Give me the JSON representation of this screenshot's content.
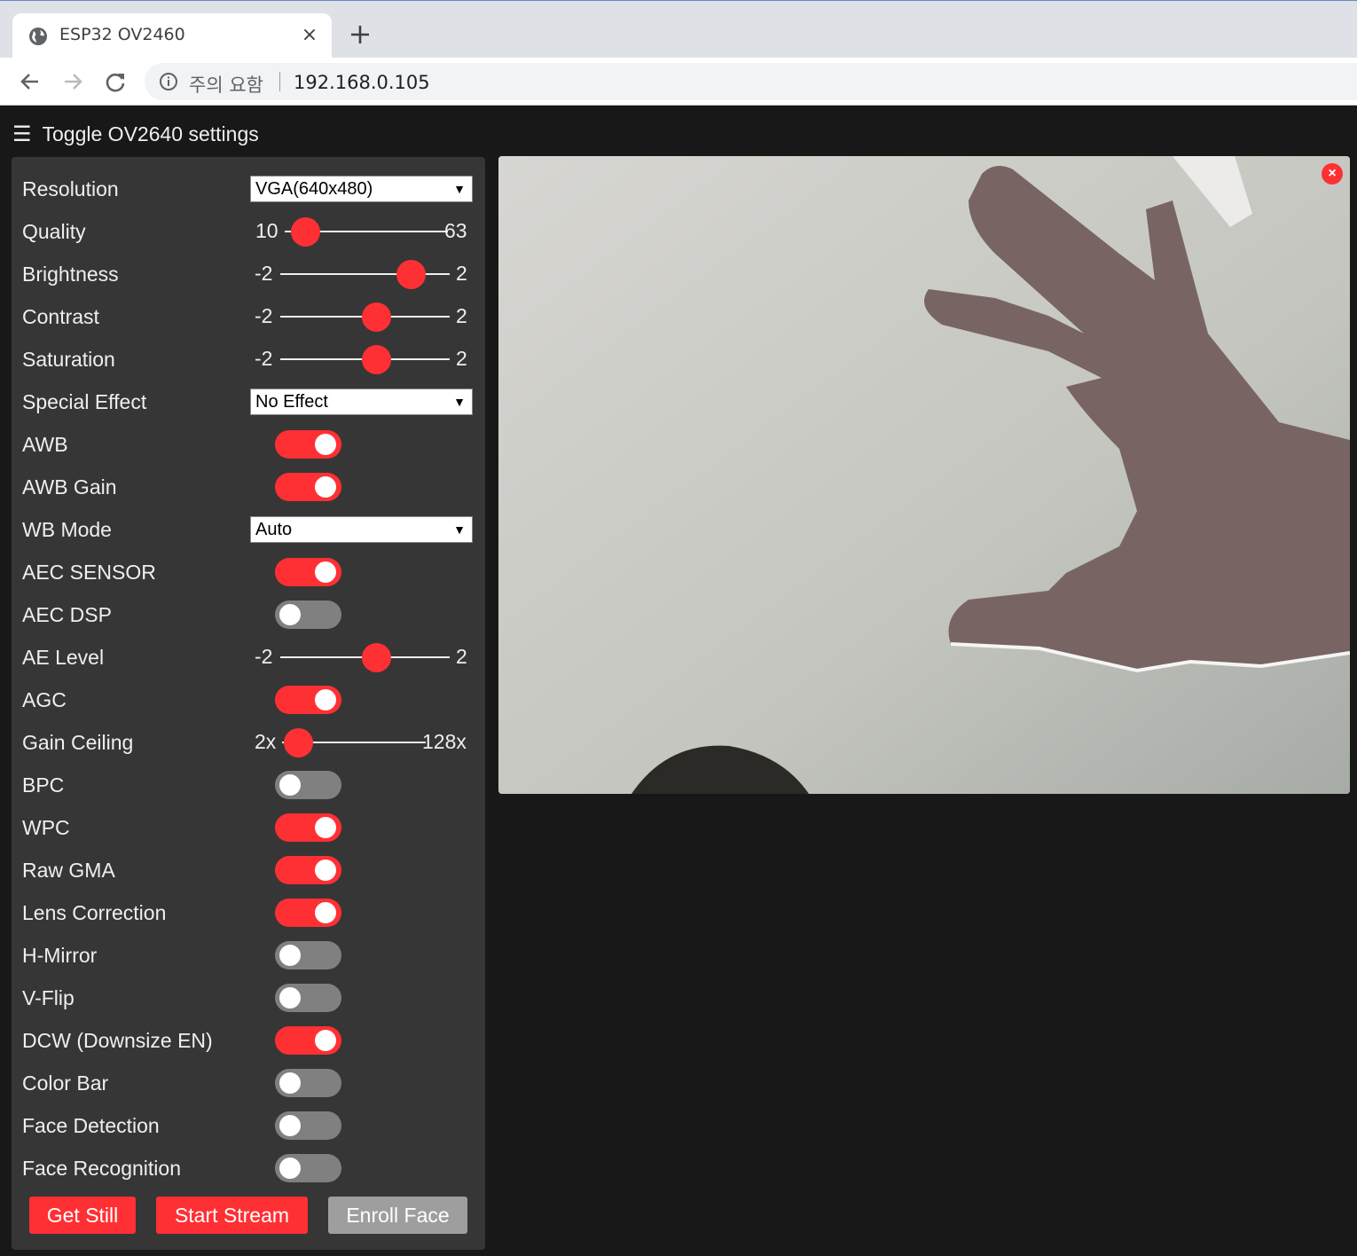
{
  "browser": {
    "tab_title": "ESP32 OV2460",
    "tab_close": "×",
    "security_text": "주의 요함",
    "url": "192.168.0.105"
  },
  "page": {
    "toggle_icon": "☰",
    "toggle_label": "Toggle OV2640 settings",
    "stream_close": "×"
  },
  "settings": {
    "resolution": {
      "label": "Resolution",
      "value": "VGA(640x480)"
    },
    "quality": {
      "label": "Quality",
      "min": "10",
      "max": "63",
      "value": 10
    },
    "brightness": {
      "label": "Brightness",
      "min": "-2",
      "max": "2",
      "value": 1
    },
    "contrast": {
      "label": "Contrast",
      "min": "-2",
      "max": "2",
      "value": 0
    },
    "saturation": {
      "label": "Saturation",
      "min": "-2",
      "max": "2",
      "value": 0
    },
    "special_effect": {
      "label": "Special Effect",
      "value": "No Effect"
    },
    "awb": {
      "label": "AWB",
      "on": true
    },
    "awb_gain": {
      "label": "AWB Gain",
      "on": true
    },
    "wb_mode": {
      "label": "WB Mode",
      "value": "Auto"
    },
    "aec_sensor": {
      "label": "AEC SENSOR",
      "on": true
    },
    "aec_dsp": {
      "label": "AEC DSP",
      "on": false
    },
    "ae_level": {
      "label": "AE Level",
      "min": "-2",
      "max": "2",
      "value": 0
    },
    "agc": {
      "label": "AGC",
      "on": true
    },
    "gain_ceiling": {
      "label": "Gain Ceiling",
      "min": "2x",
      "max": "128x",
      "value": 0
    },
    "bpc": {
      "label": "BPC",
      "on": false
    },
    "wpc": {
      "label": "WPC",
      "on": true
    },
    "raw_gma": {
      "label": "Raw GMA",
      "on": true
    },
    "lens_correction": {
      "label": "Lens Correction",
      "on": true
    },
    "h_mirror": {
      "label": "H-Mirror",
      "on": false
    },
    "v_flip": {
      "label": "V-Flip",
      "on": false
    },
    "dcw": {
      "label": "DCW (Downsize EN)",
      "on": true
    },
    "color_bar": {
      "label": "Color Bar",
      "on": false
    },
    "face_detection": {
      "label": "Face Detection",
      "on": false
    },
    "face_recognition": {
      "label": "Face Recognition",
      "on": false
    }
  },
  "buttons": {
    "get_still": "Get Still",
    "start_stream": "Start Stream",
    "enroll_face": "Enroll Face"
  },
  "colors": {
    "accent": "#ff3034",
    "panel": "#363636",
    "background": "#181818",
    "disabled": "#9e9e9e"
  }
}
